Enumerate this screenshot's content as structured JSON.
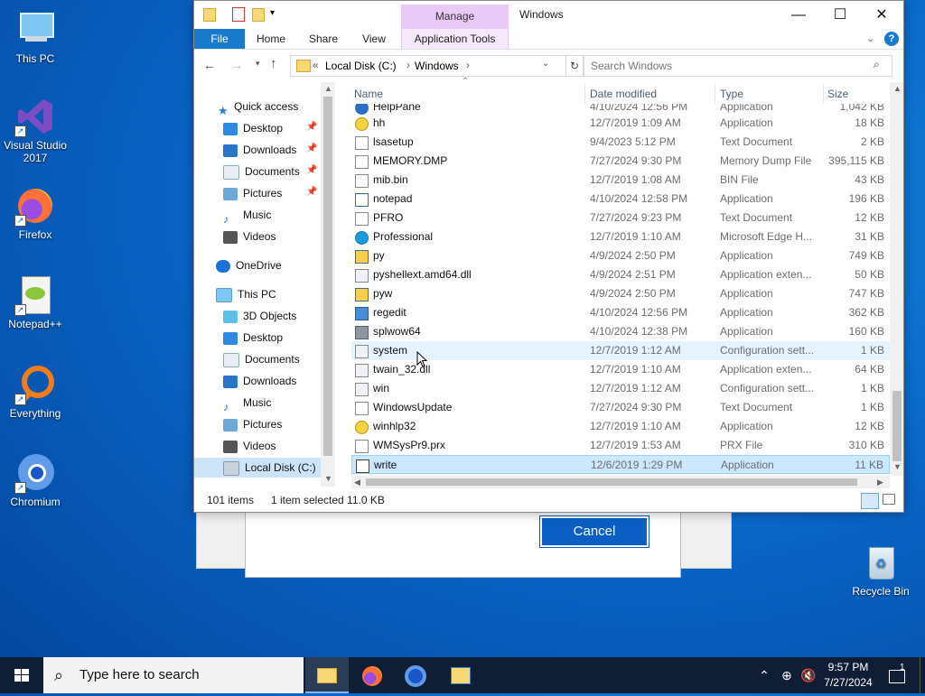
{
  "desktop": {
    "icons": [
      {
        "label": "This PC"
      },
      {
        "label": "Visual Studio 2017"
      },
      {
        "label": "Firefox"
      },
      {
        "label": "Notepad++"
      },
      {
        "label": "Everything"
      },
      {
        "label": "Chromium"
      },
      {
        "label": "Recycle Bin"
      }
    ]
  },
  "dialog": {
    "cancel_label": "Cancel"
  },
  "explorer": {
    "title": "Windows",
    "manage_label": "Manage",
    "tabs": [
      "File",
      "Home",
      "Share",
      "View",
      "Application Tools"
    ],
    "address": {
      "prefix": "«",
      "parts": [
        "Local Disk (C:)",
        "Windows"
      ]
    },
    "search_placeholder": "Search Windows",
    "nav": {
      "quick_access": "Quick access",
      "quick_items": [
        "Desktop",
        "Downloads",
        "Documents",
        "Pictures",
        "Music",
        "Videos"
      ],
      "onedrive": "OneDrive",
      "this_pc": "This PC",
      "pc_items": [
        "3D Objects",
        "Desktop",
        "Documents",
        "Downloads",
        "Music",
        "Pictures",
        "Videos",
        "Local Disk (C:)"
      ]
    },
    "columns": {
      "name": "Name",
      "date": "Date modified",
      "type": "Type",
      "size": "Size"
    },
    "files": [
      {
        "name": "HelpPane",
        "date": "4/10/2024 12:56 PM",
        "type": "Application",
        "size": "1,042 KB"
      },
      {
        "name": "hh",
        "date": "12/7/2019 1:09 AM",
        "type": "Application",
        "size": "18 KB"
      },
      {
        "name": "lsasetup",
        "date": "9/4/2023 5:12 PM",
        "type": "Text Document",
        "size": "2 KB"
      },
      {
        "name": "MEMORY.DMP",
        "date": "7/27/2024 9:30 PM",
        "type": "Memory Dump File",
        "size": "395,115 KB"
      },
      {
        "name": "mib.bin",
        "date": "12/7/2019 1:08 AM",
        "type": "BIN File",
        "size": "43 KB"
      },
      {
        "name": "notepad",
        "date": "4/10/2024 12:58 PM",
        "type": "Application",
        "size": "196 KB"
      },
      {
        "name": "PFRO",
        "date": "7/27/2024 9:23 PM",
        "type": "Text Document",
        "size": "12 KB"
      },
      {
        "name": "Professional",
        "date": "12/7/2019 1:10 AM",
        "type": "Microsoft Edge H...",
        "size": "31 KB"
      },
      {
        "name": "py",
        "date": "4/9/2024 2:50 PM",
        "type": "Application",
        "size": "749 KB"
      },
      {
        "name": "pyshellext.amd64.dll",
        "date": "4/9/2024 2:51 PM",
        "type": "Application exten...",
        "size": "50 KB"
      },
      {
        "name": "pyw",
        "date": "4/9/2024 2:50 PM",
        "type": "Application",
        "size": "747 KB"
      },
      {
        "name": "regedit",
        "date": "4/10/2024 12:56 PM",
        "type": "Application",
        "size": "362 KB"
      },
      {
        "name": "splwow64",
        "date": "4/10/2024 12:38 PM",
        "type": "Application",
        "size": "160 KB"
      },
      {
        "name": "system",
        "date": "12/7/2019 1:12 AM",
        "type": "Configuration sett...",
        "size": "1 KB"
      },
      {
        "name": "twain_32.dll",
        "date": "12/7/2019 1:10 AM",
        "type": "Application exten...",
        "size": "64 KB"
      },
      {
        "name": "win",
        "date": "12/7/2019 1:12 AM",
        "type": "Configuration sett...",
        "size": "1 KB"
      },
      {
        "name": "WindowsUpdate",
        "date": "7/27/2024 9:30 PM",
        "type": "Text Document",
        "size": "1 KB"
      },
      {
        "name": "winhlp32",
        "date": "12/7/2019 1:10 AM",
        "type": "Application",
        "size": "12 KB"
      },
      {
        "name": "WMSysPr9.prx",
        "date": "12/7/2019 1:53 AM",
        "type": "PRX File",
        "size": "310 KB"
      },
      {
        "name": "write",
        "date": "12/6/2019 1:29 PM",
        "type": "Application",
        "size": "11 KB"
      }
    ],
    "status": {
      "count": "101 items",
      "selected": "1 item selected  11.0 KB"
    }
  },
  "taskbar": {
    "search_placeholder": "Type here to search",
    "time": "9:57 PM",
    "date": "7/27/2024",
    "notifications": "1"
  }
}
